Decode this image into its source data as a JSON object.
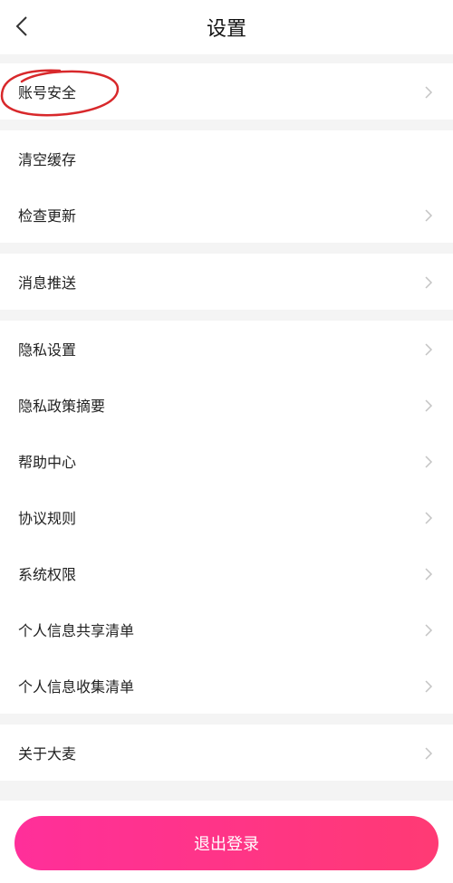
{
  "header": {
    "title": "设置",
    "back_icon": "chevron-left-icon"
  },
  "groups": [
    {
      "items": [
        {
          "label": "账号安全",
          "chevron": true
        }
      ]
    },
    {
      "items": [
        {
          "label": "清空缓存",
          "chevron": false
        },
        {
          "label": "检查更新",
          "chevron": true
        }
      ]
    },
    {
      "items": [
        {
          "label": "消息推送",
          "chevron": true
        }
      ]
    },
    {
      "items": [
        {
          "label": "隐私设置",
          "chevron": true
        },
        {
          "label": "隐私政策摘要",
          "chevron": true
        },
        {
          "label": "帮助中心",
          "chevron": true
        },
        {
          "label": "协议规则",
          "chevron": true
        },
        {
          "label": "系统权限",
          "chevron": true
        },
        {
          "label": "个人信息共享清单",
          "chevron": true
        },
        {
          "label": "个人信息收集清单",
          "chevron": true
        }
      ]
    },
    {
      "items": [
        {
          "label": "关于大麦",
          "chevron": true
        }
      ]
    }
  ],
  "logout": {
    "label": "退出登录"
  },
  "colors": {
    "accent_start": "#ff2f9a",
    "accent_end": "#ff3a74",
    "annotation": "#d8282b"
  }
}
